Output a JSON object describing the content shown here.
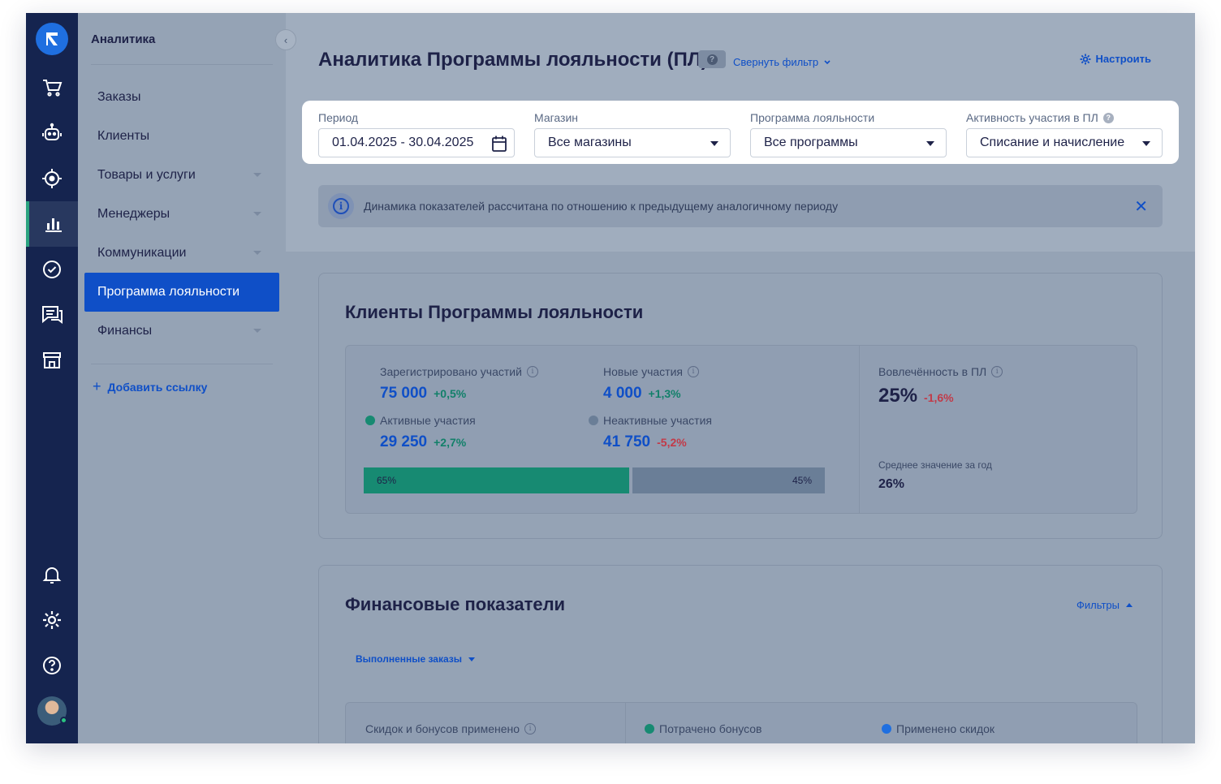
{
  "sidebar": {
    "title": "Аналитика",
    "items": [
      {
        "label": "Заказы"
      },
      {
        "label": "Клиенты"
      },
      {
        "label": "Товары и услуги"
      },
      {
        "label": "Менеджеры"
      },
      {
        "label": "Коммуникации"
      },
      {
        "label": "Программа лояльности"
      },
      {
        "label": "Финансы"
      }
    ],
    "add_link": "Добавить ссылку"
  },
  "header": {
    "title": "Аналитика Программы лояльности (ПЛ)",
    "help": "?",
    "collapse_filter": "Свернуть фильтр",
    "configure": "Настроить"
  },
  "filters": {
    "period": {
      "label": "Период",
      "value": "01.04.2025 - 30.04.2025"
    },
    "shop": {
      "label": "Магазин",
      "value": "Все магазины"
    },
    "program": {
      "label": "Программа лояльности",
      "value": "Все программы"
    },
    "activity": {
      "label": "Активность участия в ПЛ",
      "value": "Списание и начисление"
    }
  },
  "notice": {
    "text": "Динамика показателей рассчитана по отношению к предыдущему аналогичному периоду",
    "close": "✕"
  },
  "clients_card": {
    "title": "Клиенты Программы лояльности",
    "registered": {
      "label": "Зарегистрировано участий",
      "value": "75 000",
      "delta": "+0,5%"
    },
    "new": {
      "label": "Новые участия",
      "value": "4 000",
      "delta": "+1,3%"
    },
    "active": {
      "label": "Активные участия",
      "value": "29 250",
      "delta": "+2,7%"
    },
    "inactive": {
      "label": "Неактивные участия",
      "value": "41 750",
      "delta": "-5,2%"
    },
    "bar": {
      "active_pct": 65,
      "active_label": "65%",
      "inactive_pct": 45,
      "inactive_label": "45%"
    },
    "engagement": {
      "label": "Вовлечённость в ПЛ",
      "value": "25%",
      "delta": "-1,6%"
    },
    "yearly": {
      "label": "Среднее значение за год",
      "value": "26%"
    }
  },
  "finance_card": {
    "title": "Финансовые показатели",
    "filters_link": "Фильтры",
    "orders_select": "Выполненные заказы",
    "applied_label": "Скидок и бонусов применено",
    "spent_label": "Потрачено бонусов",
    "discounts_label": "Применено скидок"
  },
  "colors": {
    "accent": "#0f4fc7",
    "active_green": "#178a72",
    "inactive_gray": "#6a7e97",
    "rail": "#15244f"
  }
}
